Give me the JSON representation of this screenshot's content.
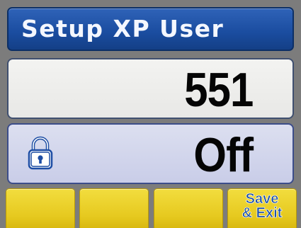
{
  "header": {
    "title": "Setup XP User"
  },
  "user_panel": {
    "user_number": "551"
  },
  "lock_panel": {
    "icon": "padlock-icon",
    "status": "Off"
  },
  "softkeys": [
    {
      "label": ""
    },
    {
      "label": ""
    },
    {
      "label": ""
    },
    {
      "label": "Save\n& Exit"
    }
  ],
  "colors": {
    "title_bar": "#1a4c9f",
    "softkey": "#e6c91f",
    "softkey_text": "#1b4fa6",
    "lock_panel": "#c9cde8"
  }
}
